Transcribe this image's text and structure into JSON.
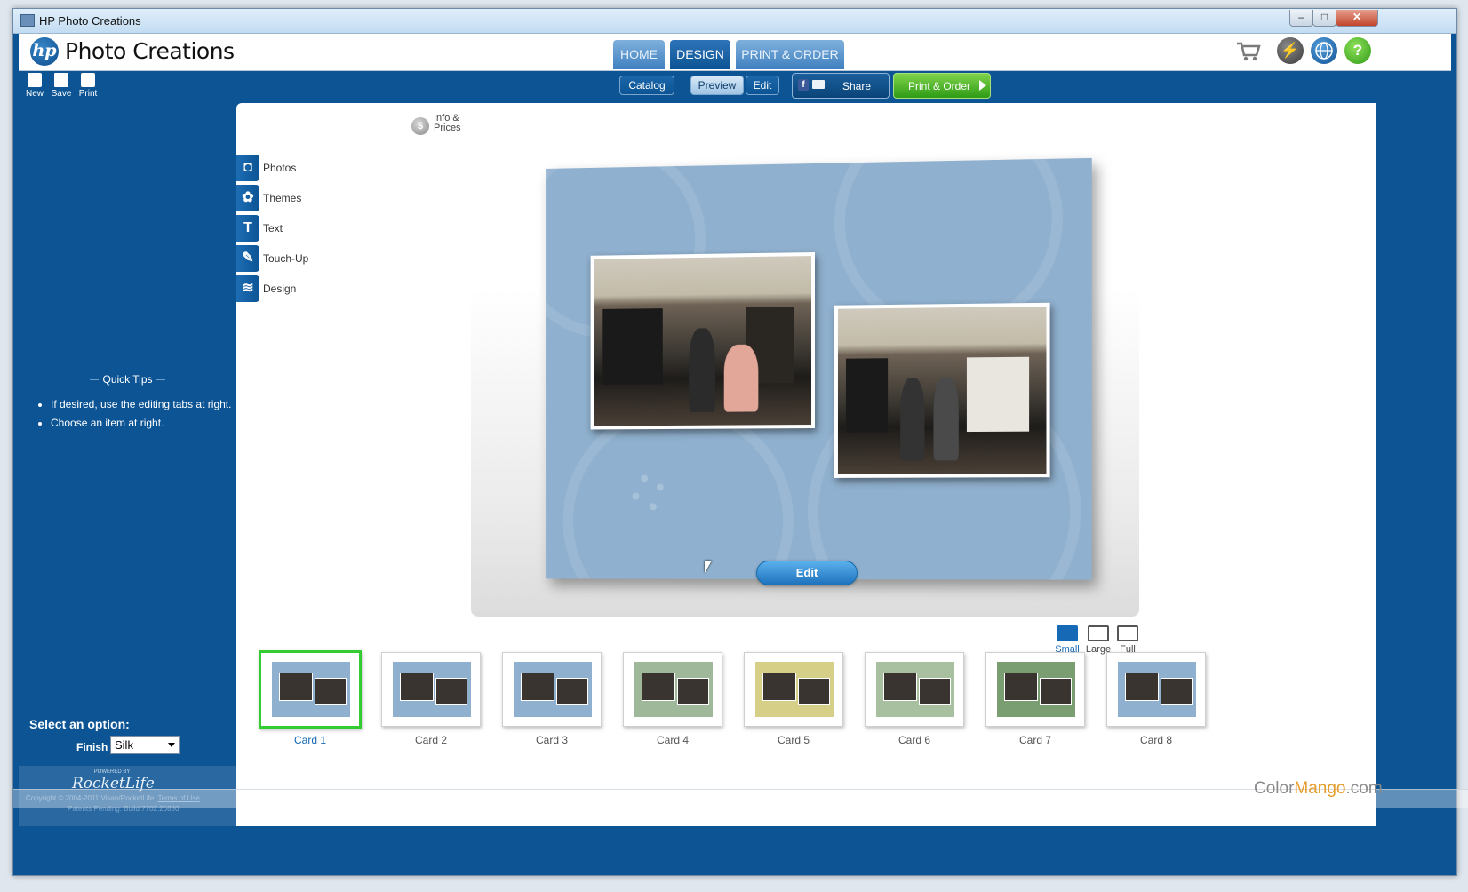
{
  "window": {
    "title": "HP Photo Creations",
    "minimize": "–",
    "maximize": "□",
    "close": "✕"
  },
  "header": {
    "logo_text": "hp",
    "app_name": "Photo Creations",
    "tabs": [
      {
        "label": "HOME",
        "active": false
      },
      {
        "label": "DESIGN",
        "active": true
      },
      {
        "label": "PRINT & ORDER",
        "active": false
      }
    ],
    "icons": [
      "cart-icon",
      "lightning-icon",
      "globe-icon",
      "help-icon"
    ],
    "help_glyph": "?",
    "lightning_glyph": "⚡"
  },
  "toolbar": {
    "new_label": "New",
    "save_label": "Save",
    "print_label": "Print",
    "catalog_label": "Catalog",
    "preview_label": "Preview",
    "edit_label": "Edit",
    "share_label": "Share",
    "share_fb": "f",
    "print_order_label": "Print & Order",
    "active_view": "Preview"
  },
  "sidebar": {
    "tips_title": "Quick Tips",
    "tips": [
      "If desired, use the editing tabs at right.",
      "Choose an item at right."
    ],
    "option_title": "Select an option:",
    "finish_label": "Finish",
    "finish_value": "Silk",
    "powered_by": "POWERED BY",
    "rocketlife": "RocketLife",
    "copyright": "Copyright © 2004-2011 Visan/RocketLife.",
    "terms": "Terms of Use",
    "patents": "Patents Pending. Build 7702.26830"
  },
  "main": {
    "info_prices": "Info & Prices",
    "info_coin": "$",
    "side_tabs": [
      {
        "label": "Photos",
        "icon": "camera-icon",
        "glyph": "◘"
      },
      {
        "label": "Themes",
        "icon": "themes-icon",
        "glyph": "✿"
      },
      {
        "label": "Text",
        "icon": "text-icon",
        "glyph": "T"
      },
      {
        "label": "Touch-Up",
        "icon": "touchup-icon",
        "glyph": "✎"
      },
      {
        "label": "Design",
        "icon": "design-icon",
        "glyph": "≋"
      }
    ],
    "edit_button": "Edit",
    "size_options": [
      {
        "label": "Small",
        "active": true
      },
      {
        "label": "Large",
        "active": false
      },
      {
        "label": "Full",
        "active": false
      }
    ],
    "cards": [
      {
        "label": "Card 1",
        "bg": "#8fb0ce",
        "selected": true
      },
      {
        "label": "Card 2",
        "bg": "#8fb0ce",
        "selected": false
      },
      {
        "label": "Card 3",
        "bg": "#8fb0ce",
        "selected": false
      },
      {
        "label": "Card 4",
        "bg": "#9fb89a",
        "selected": false
      },
      {
        "label": "Card 5",
        "bg": "#d6cf88",
        "selected": false
      },
      {
        "label": "Card 6",
        "bg": "#a8c0a0",
        "selected": false
      },
      {
        "label": "Card 7",
        "bg": "#7a9e72",
        "selected": false
      },
      {
        "label": "Card 8",
        "bg": "#8fb0ce",
        "selected": false
      }
    ]
  },
  "watermark": {
    "part1": "Color",
    "part2": "Mango",
    "part3": ".com"
  },
  "colors": {
    "brand_blue": "#0c5494",
    "selected_green": "#33cc33",
    "order_green": "#2f9b16",
    "card_blue": "#8fb0ce"
  }
}
